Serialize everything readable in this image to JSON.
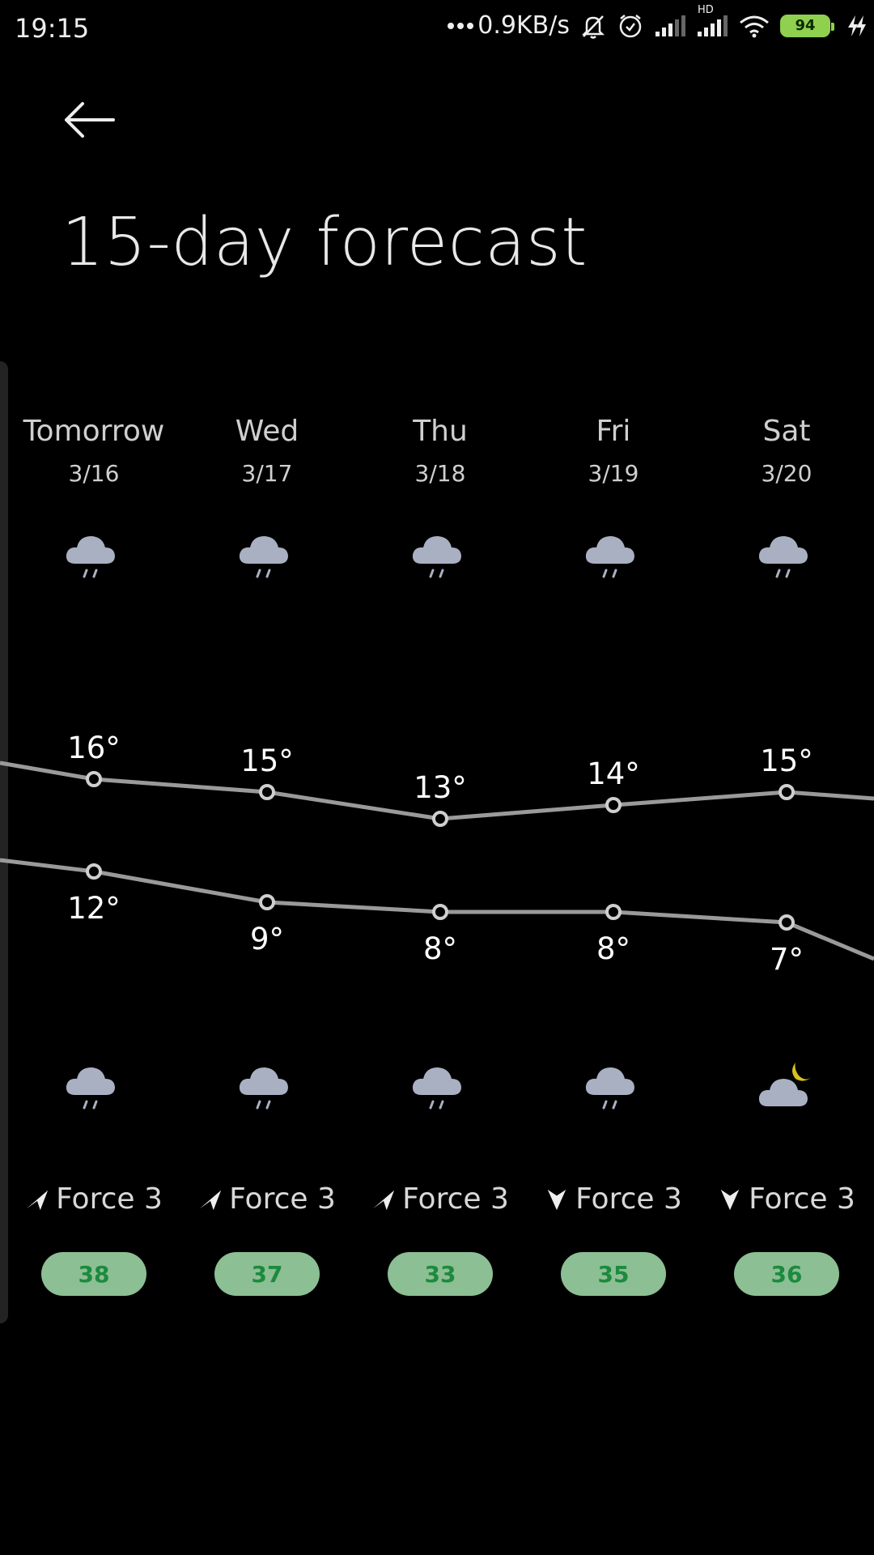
{
  "status_bar": {
    "time": "19:15",
    "network_speed": "0.9KB/s",
    "battery": "94",
    "hd_label": "HD"
  },
  "header": {
    "title": "15-day forecast"
  },
  "days": [
    {
      "name": "Tomorrow",
      "date": "3/16",
      "high": "16°",
      "low": "12°",
      "day_icon": "rain-icon",
      "night_icon": "rain-icon",
      "wind_dir": "northeast",
      "wind": "Force 3",
      "aqi": "38"
    },
    {
      "name": "Wed",
      "date": "3/17",
      "high": "15°",
      "low": "9°",
      "day_icon": "rain-icon",
      "night_icon": "rain-icon",
      "wind_dir": "northeast",
      "wind": "Force 3",
      "aqi": "37"
    },
    {
      "name": "Thu",
      "date": "3/18",
      "high": "13°",
      "low": "8°",
      "day_icon": "rain-icon",
      "night_icon": "rain-icon",
      "wind_dir": "northeast",
      "wind": "Force 3",
      "aqi": "33"
    },
    {
      "name": "Fri",
      "date": "3/19",
      "high": "14°",
      "low": "8°",
      "day_icon": "rain-icon",
      "night_icon": "rain-icon",
      "wind_dir": "south",
      "wind": "Force 3",
      "aqi": "35"
    },
    {
      "name": "Sat",
      "date": "3/20",
      "high": "15°",
      "low": "7°",
      "day_icon": "rain-icon",
      "night_icon": "partly-cloudy-night-icon",
      "wind_dir": "south",
      "wind": "Force 3",
      "aqi": "36"
    }
  ],
  "colors": {
    "background": "#000000",
    "line": "#9a9a9a",
    "aqi_badge_bg": "#8cbf94",
    "aqi_text": "#1d8a3e",
    "cloud": "#a9b0c2",
    "moon": "#d8c21a"
  }
}
